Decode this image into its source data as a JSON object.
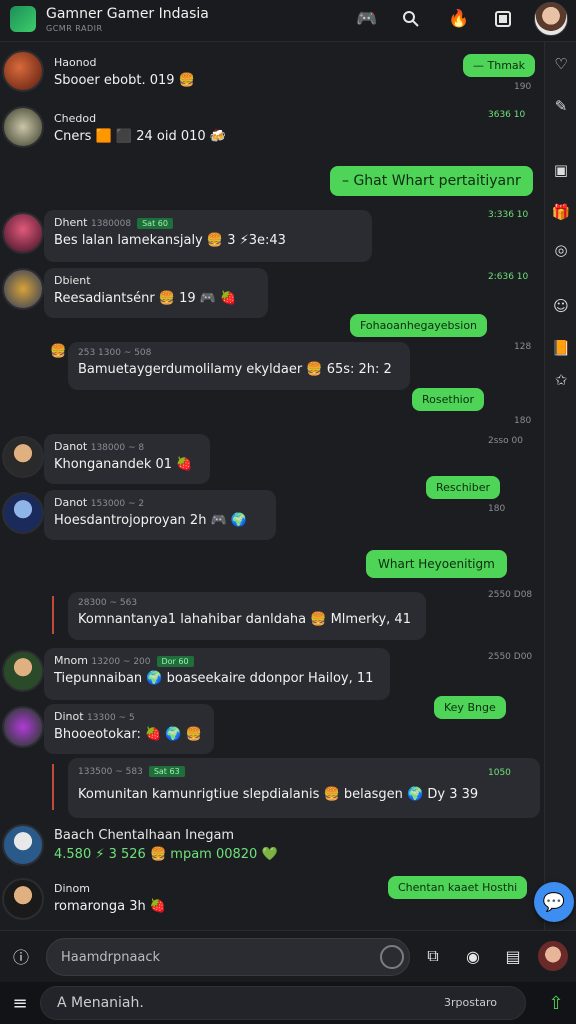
{
  "header": {
    "title": "Gamner Gamer Indasia",
    "subtitle": "GCMR RADIR",
    "icons": [
      "controller-icon",
      "search-icon",
      "fire-notification-icon",
      "window-icon",
      "user-avatar"
    ]
  },
  "rail": {
    "icons": [
      "heart-icon",
      "edit-icon",
      "calendar-icon",
      "gift-icon",
      "game-icon",
      "smile-icon",
      "book-icon",
      "star-icon"
    ]
  },
  "messages": [
    {
      "type": "in",
      "name": "Haonod",
      "text": "Sbooer ebobt. 019 🍔",
      "meta": ""
    },
    {
      "type": "out",
      "text": "— Thmak",
      "time": "190"
    },
    {
      "type": "in",
      "name": "Chedod",
      "text": "Cners 🟧 ⬛ 24 oid 010 🍻",
      "meta": ""
    },
    {
      "type": "out_time",
      "time": "3636 10"
    },
    {
      "type": "out",
      "text": "– Ghat Whart pertaitiyanr",
      "time": "3:336 10"
    },
    {
      "type": "in",
      "name": "Dhent",
      "meta": "1380008",
      "tag": "Sat 60",
      "text": "Bes lalan lamekansjaly 🍔 3 ⚡3e:43"
    },
    {
      "type": "in",
      "name": "Dbient",
      "meta": "",
      "text": "Reesadiantsénr 🍔 19 🎮 🍓"
    },
    {
      "type": "out",
      "text": "Fohaoanhegayebsion",
      "time": "2:636 10"
    },
    {
      "type": "in",
      "name": "",
      "meta": "253 1300 ~ 508",
      "text": "Bamuetaygerdumolilamy ekyldaer 🍔 65s: 2h: 2"
    },
    {
      "type": "out",
      "text": "Rosethior",
      "time": "128"
    },
    {
      "type": "in",
      "name": "Danot",
      "meta": "138000 ~ 8",
      "text": "Khonganandek 01 🍓"
    },
    {
      "type": "out_time",
      "time": "180"
    },
    {
      "type": "in",
      "name": "Danot",
      "meta": "153000 ~ 2",
      "text": "Hoesdantrojoproyan 2h 🎮 🌍"
    },
    {
      "type": "out",
      "text": "Reschiber",
      "time": "2sso 00"
    },
    {
      "type": "out",
      "text": "Whart Heyoenitigm",
      "time": "2550 D08"
    },
    {
      "type": "in",
      "name": "",
      "meta": "28300 ~ 563",
      "text": "Komnantanya1 lahahibar danldaha 🍔 Mlmerky, 41"
    },
    {
      "type": "in",
      "name": "Mnom",
      "meta": "13200 ~ 200",
      "tag": "Dor 60",
      "text": "Tiepunnaiban 🌍 boaseekaire ddonpor Hailoy, 11"
    },
    {
      "type": "out",
      "text": "Key Bnge",
      "time": "2550 D00"
    },
    {
      "type": "in",
      "name": "Dinot",
      "meta": "13300 ~ 5",
      "text": "Bhooeotokar: 🍓 🌍 🍔"
    },
    {
      "type": "in",
      "name": "",
      "meta": "133500 ~ 583",
      "tag": "Sat 63",
      "text": "Komunitan kamunrigtiue slepdialanis 🍔 belasgen 🌍 Dy 3 39"
    },
    {
      "type": "in",
      "name": "Baach Chentalhaan Inegam",
      "meta": "",
      "text": "4.580 ⚡ 3 526 🍔 mpam 00820 💚"
    },
    {
      "type": "in",
      "name": "Dinom",
      "meta": "",
      "text": "romaronga 3h 🍓"
    },
    {
      "type": "out",
      "text": "Chentan kaaet Hosthi",
      "time": "1050"
    }
  ],
  "composer": {
    "placeholder": "Haamdrpnaack",
    "icons": [
      "info-icon",
      "emoji-icon",
      "copy-icon",
      "record-icon",
      "image-icon"
    ]
  },
  "bottombar": {
    "placeholder": "A Menaniah.",
    "right_text": "3rpostaro"
  }
}
